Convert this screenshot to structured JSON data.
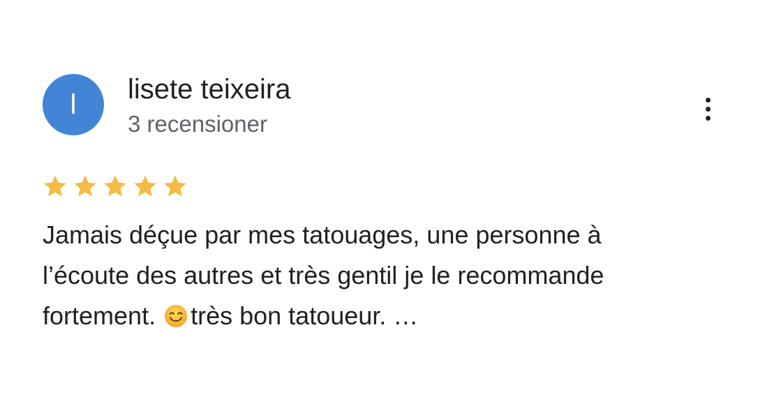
{
  "review": {
    "avatar_initial": "l",
    "author_name": "lisete teixeira",
    "author_reviews": "3 recensioner",
    "rating": 5,
    "rating_max": 5,
    "text_line1": "Jamais déçue par mes tatouages, une personne à",
    "text_line2": "l’écoute des autres et très gentil je le recommande",
    "text_line3_a": "fortement.",
    "text_line3_b": "très bon tatoueur. …",
    "emoji_icon": "smiling-face-emoji"
  },
  "colors": {
    "avatar_bg": "#4285d6",
    "star": "#f6bb42",
    "text": "#202124",
    "secondary_text": "#5f6368"
  }
}
